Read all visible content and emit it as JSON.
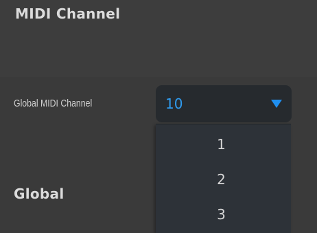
{
  "midi_section": {
    "title": "MIDI Channel",
    "global_midi_channel": {
      "label": "Global MIDI Channel",
      "value": "10",
      "arrow_icon": "triangle-down-icon",
      "accent_color": "#2f9cf0",
      "options_visible": [
        "1",
        "2",
        "3"
      ]
    }
  },
  "global_section": {
    "title": "Global"
  }
}
